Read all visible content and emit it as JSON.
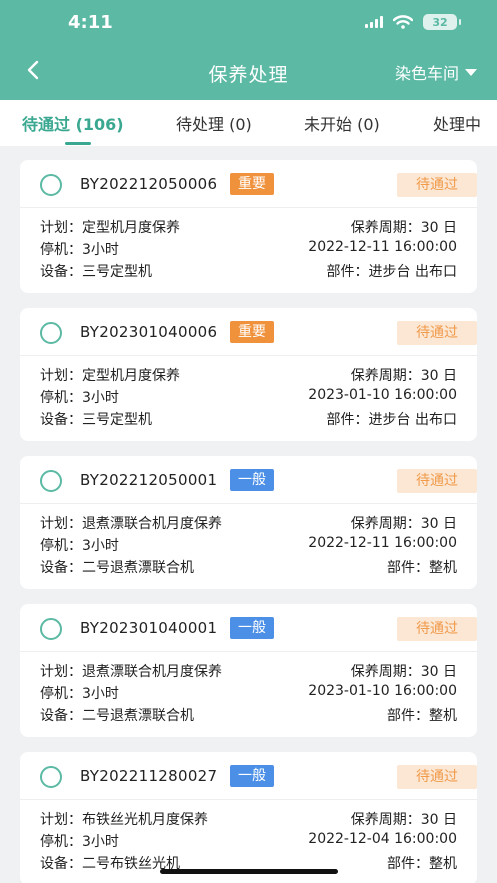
{
  "status_bar": {
    "time": "4:11",
    "battery": "32"
  },
  "header": {
    "title": "保养处理",
    "workshop": "染色车间"
  },
  "tabs": [
    {
      "label": "待通过 (106)"
    },
    {
      "label": "待处理 (0)"
    },
    {
      "label": "未开始 (0)"
    },
    {
      "label": "处理中"
    }
  ],
  "labels": {
    "plan": "计划：",
    "stop": "停机：",
    "equip": "设备：",
    "cycle": "保养周期：",
    "part": "部件："
  },
  "colors": {
    "primary": "#5bb9a4",
    "important": "#f0913c",
    "normal": "#4b90e6",
    "pending_bg": "#fbe7d3",
    "pending_text": "#f19a4a"
  },
  "cards": [
    {
      "code": "BY202212050006",
      "priority": "重要",
      "priority_type": "important",
      "status": "待通过",
      "plan": "定型机月度保养",
      "cycle": "30 日",
      "stop": "3小时",
      "time": "2022-12-11 16:00:00",
      "equip": "三号定型机",
      "part": "进步台 出布口"
    },
    {
      "code": "BY202301040006",
      "priority": "重要",
      "priority_type": "important",
      "status": "待通过",
      "plan": "定型机月度保养",
      "cycle": "30 日",
      "stop": "3小时",
      "time": "2023-01-10 16:00:00",
      "equip": "三号定型机",
      "part": "进步台 出布口"
    },
    {
      "code": "BY202212050001",
      "priority": "一般",
      "priority_type": "normal",
      "status": "待通过",
      "plan": "退煮漂联合机月度保养",
      "cycle": "30 日",
      "stop": "3小时",
      "time": "2022-12-11 16:00:00",
      "equip": "二号退煮漂联合机",
      "part": "整机"
    },
    {
      "code": "BY202301040001",
      "priority": "一般",
      "priority_type": "normal",
      "status": "待通过",
      "plan": "退煮漂联合机月度保养",
      "cycle": "30 日",
      "stop": "3小时",
      "time": "2023-01-10 16:00:00",
      "equip": "二号退煮漂联合机",
      "part": "整机"
    },
    {
      "code": "BY202211280027",
      "priority": "一般",
      "priority_type": "normal",
      "status": "待通过",
      "plan": "布铁丝光机月度保养",
      "cycle": "30 日",
      "stop": "3小时",
      "time": "2022-12-04 16:00:00",
      "equip": "二号布铁丝光机",
      "part": "整机"
    }
  ]
}
